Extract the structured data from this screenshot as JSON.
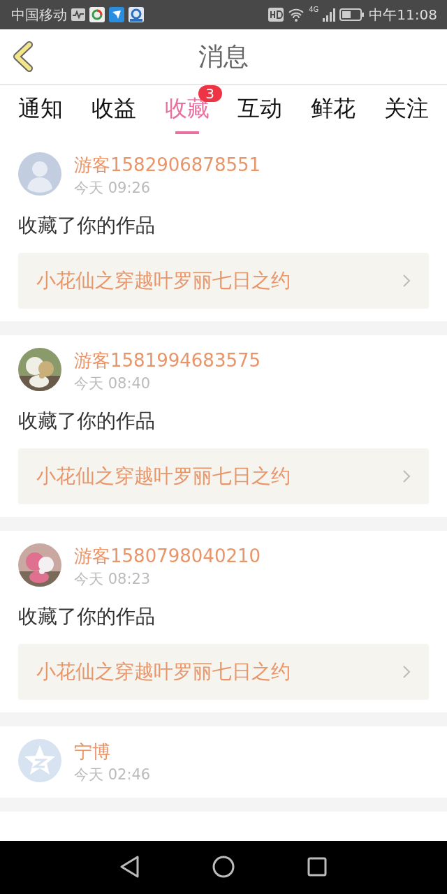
{
  "status_bar": {
    "carrier": "中国移动",
    "network": "4G",
    "time": "中午11:08"
  },
  "header": {
    "title": "消息"
  },
  "tabs": [
    {
      "label": "通知",
      "selected": false
    },
    {
      "label": "收益",
      "selected": false
    },
    {
      "label": "收藏",
      "selected": true,
      "badge": "3"
    },
    {
      "label": "互动",
      "selected": false
    },
    {
      "label": "鲜花",
      "selected": false
    },
    {
      "label": "关注",
      "selected": false
    }
  ],
  "messages": [
    {
      "avatar": {
        "kind": "default"
      },
      "name": "游客1582906878551",
      "time": "今天 09:26",
      "text": "收藏了你的作品",
      "work": "小花仙之穿越叶罗丽七日之约"
    },
    {
      "name": "游客1581994683575",
      "time": "今天 08:40",
      "text": "收藏了你的作品",
      "work": "小花仙之穿越叶罗丽七日之约"
    },
    {
      "name": "游客1580798040210",
      "time": "今天 08:23",
      "text": "收藏了你的作品",
      "work": "小花仙之穿越叶罗丽七日之约"
    },
    {
      "avatar": {
        "kind": "star"
      },
      "name": "宁博",
      "time": "今天 02:46"
    }
  ]
}
